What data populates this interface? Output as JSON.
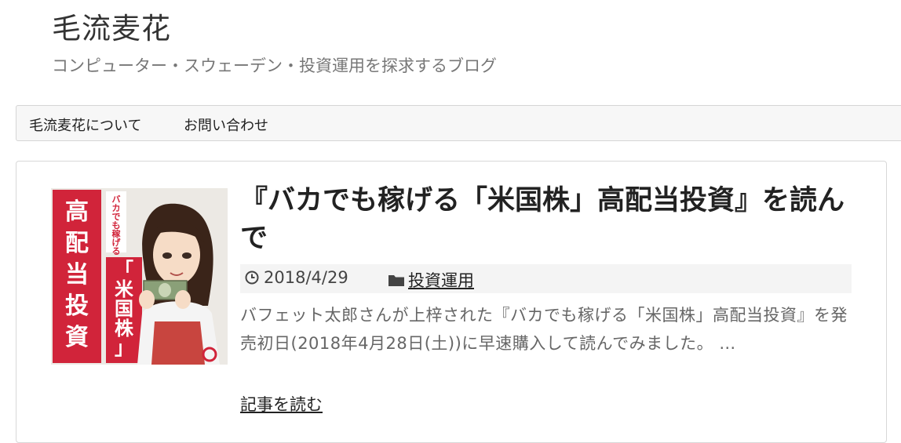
{
  "site": {
    "title": "毛流麦花",
    "description": "コンピューター・スウェーデン・投資運用を探求するブログ"
  },
  "nav": {
    "items": [
      {
        "label": "毛流麦花について"
      },
      {
        "label": "お問い合わせ"
      }
    ]
  },
  "post": {
    "title": "『バカでも稼げる「米国株」高配当投資』を読んで",
    "date": "2018/4/29",
    "category": "投資運用",
    "excerpt": "バフェット太郎さんが上梓された『バカでも稼げる「米国株」高配当投資』を発売初日(2018年4月28日(土))に早速購入して読んでみました。 …",
    "read_more": "記事を読む",
    "thumbnail": {
      "cover_small_text": "バカでも稼げる",
      "cover_title_left": "高配当投資",
      "cover_title_right": "「米国株」",
      "colors": {
        "red": "#d1243a",
        "cream": "#f2efe9"
      }
    }
  },
  "icons": {
    "date": "clock-icon",
    "category": "folder-icon"
  }
}
